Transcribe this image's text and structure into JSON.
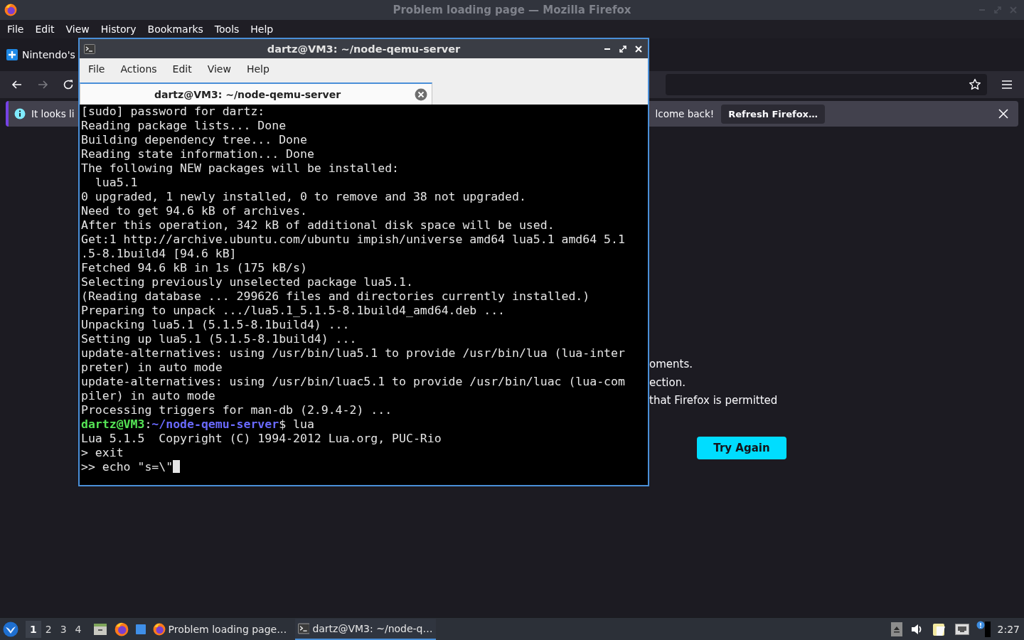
{
  "firefox": {
    "title": "Problem loading page — Mozilla Firefox",
    "menus": [
      {
        "label": "File"
      },
      {
        "label": "Edit"
      },
      {
        "label": "View"
      },
      {
        "label": "History"
      },
      {
        "label": "Bookmarks"
      },
      {
        "label": "Tools"
      },
      {
        "label": "Help"
      }
    ],
    "tabs": [
      {
        "label": "Nintendo's"
      }
    ],
    "nav": {
      "forward_disabled": true
    },
    "notification": {
      "text_start": "It looks li",
      "text_end": "lcome back!",
      "button": {
        "label": "Refresh Firefox…"
      }
    },
    "error_page": {
      "lines": [
        "oments.",
        "ection.",
        "that Firefox is permitted"
      ],
      "button": "Try Again"
    }
  },
  "terminal": {
    "title": "dartz@VM3: ~/node-qemu-server",
    "menus": [
      "File",
      "Actions",
      "Edit",
      "View",
      "Help"
    ],
    "tabs": [
      {
        "label": "dartz@VM3: ~/node-qemu-server",
        "selected": true
      }
    ],
    "lines": [
      {
        "kind": "output",
        "text": "[sudo] password for dartz:"
      },
      {
        "kind": "output",
        "text": "Reading package lists... Done"
      },
      {
        "kind": "output",
        "text": "Building dependency tree... Done"
      },
      {
        "kind": "output",
        "text": "Reading state information... Done"
      },
      {
        "kind": "output",
        "text": "The following NEW packages will be installed:"
      },
      {
        "kind": "output",
        "text": "  lua5.1"
      },
      {
        "kind": "output",
        "text": "0 upgraded, 1 newly installed, 0 to remove and 38 not upgraded."
      },
      {
        "kind": "output",
        "text": "Need to get 94.6 kB of archives."
      },
      {
        "kind": "output",
        "text": "After this operation, 342 kB of additional disk space will be used."
      },
      {
        "kind": "output",
        "text": "Get:1 http://archive.ubuntu.com/ubuntu impish/universe amd64 lua5.1 amd64 5.1"
      },
      {
        "kind": "output",
        "text": ".5-8.1build4 [94.6 kB]"
      },
      {
        "kind": "output",
        "text": "Fetched 94.6 kB in 1s (175 kB/s)"
      },
      {
        "kind": "output",
        "text": "Selecting previously unselected package lua5.1."
      },
      {
        "kind": "output",
        "text": "(Reading database ... 299626 files and directories currently installed.)"
      },
      {
        "kind": "output",
        "text": "Preparing to unpack .../lua5.1_5.1.5-8.1build4_amd64.deb ..."
      },
      {
        "kind": "output",
        "text": "Unpacking lua5.1 (5.1.5-8.1build4) ..."
      },
      {
        "kind": "output",
        "text": "Setting up lua5.1 (5.1.5-8.1build4) ..."
      },
      {
        "kind": "output",
        "text": "update-alternatives: using /usr/bin/lua5.1 to provide /usr/bin/lua (lua-inter"
      },
      {
        "kind": "output",
        "text": "preter) in auto mode"
      },
      {
        "kind": "output",
        "text": "update-alternatives: using /usr/bin/luac5.1 to provide /usr/bin/luac (lua-com"
      },
      {
        "kind": "output",
        "text": "piler) in auto mode"
      },
      {
        "kind": "output",
        "text": "Processing triggers for man-db (2.9.4-2) ..."
      },
      {
        "kind": "prompt",
        "user": "dartz@VM3",
        "sep": ":",
        "path": "~/node-qemu-server",
        "command": "$ lua"
      },
      {
        "kind": "output",
        "text": "Lua 5.1.5  Copyright (C) 1994-2012 Lua.org, PUC-Rio"
      },
      {
        "kind": "output",
        "text": "> exit"
      },
      {
        "kind": "output",
        "text": ">> echo \"s=\\\"",
        "cursor": true
      }
    ]
  },
  "taskbar": {
    "workspaces": [
      {
        "label": "1",
        "selected": true
      },
      {
        "label": "2",
        "selected": false
      },
      {
        "label": "3",
        "selected": false
      },
      {
        "label": "4",
        "selected": false
      }
    ],
    "tasks": [
      {
        "kind": "browser",
        "label": "Problem loading page…",
        "selected": false
      },
      {
        "kind": "terminal",
        "label": "dartz@VM3: ~/node-q…",
        "selected": true
      }
    ],
    "clock": "2:27"
  }
}
